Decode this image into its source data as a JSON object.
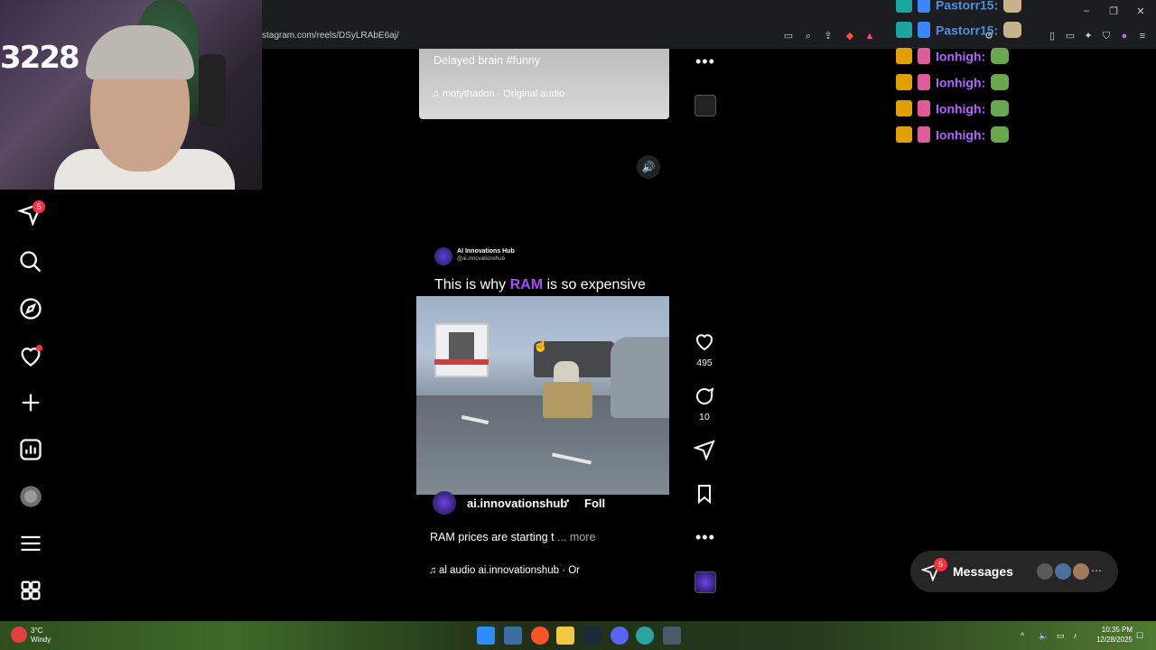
{
  "browser": {
    "url": "stagram.com/reels/DSyLRAbE6aj/"
  },
  "webcam": {
    "overlay_number": "3228"
  },
  "nav": {
    "messages_badge": "5"
  },
  "prev_reel": {
    "caption": "Delayed brain #funny",
    "audio": "motythadon · Original audio"
  },
  "reel": {
    "hub_name": "AI Innovations Hub",
    "hub_handle": "@ai.innovationshub",
    "caption_pre": "This is why ",
    "caption_hl": "RAM",
    "caption_post": " is so expensive",
    "owner": "ai.innovationshub",
    "separator": "•",
    "follow": "Foll",
    "description": "RAM prices are starting t",
    "more": "... more",
    "audio": "al audio  ai.innovationshub · Or"
  },
  "actions": {
    "likes": "495",
    "comments": "10"
  },
  "chat": [
    {
      "name": "Pastorr15:",
      "color": "#4a90e2"
    },
    {
      "name": "Pastorr15:",
      "color": "#4a90e2"
    },
    {
      "name": "Ionhigh:",
      "color": "#b362ff"
    },
    {
      "name": "Ionhigh:",
      "color": "#b362ff"
    },
    {
      "name": "Ionhigh:",
      "color": "#b362ff"
    },
    {
      "name": "Ionhigh:",
      "color": "#b362ff"
    }
  ],
  "messages": {
    "label": "Messages",
    "badge": "5"
  },
  "taskbar": {
    "temp": "3°C",
    "weather": "Windy",
    "time": "10:35 PM",
    "date": "12/28/2025"
  }
}
